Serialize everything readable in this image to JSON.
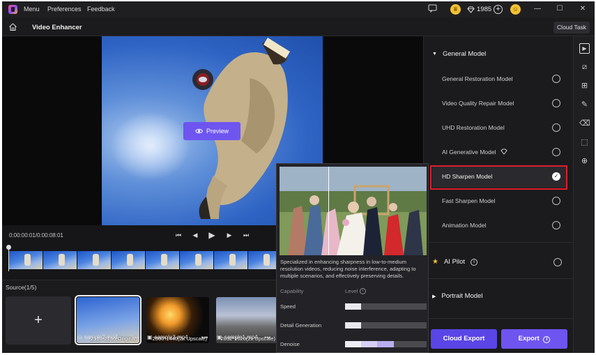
{
  "titlebar": {
    "menu": [
      "Menu",
      "Preferences",
      "Feedback"
    ],
    "credits": "1985",
    "window_controls": [
      "minimize",
      "maximize",
      "close"
    ]
  },
  "header": {
    "title": "Video Enhancer",
    "cloud_task": "Cloud Task"
  },
  "preview": {
    "button": "Preview",
    "timecode": "0:00:00:01/0:00:08:01"
  },
  "source": {
    "label": "Source(1/5)",
    "add": "+",
    "files": [
      {
        "name": "sample2.mp4",
        "resolution": "2510*2156(Original)",
        "selected": true
      },
      {
        "name": "sample3.mp4",
        "resolution": "2560*1440(2x Upscale)",
        "selected": false
      },
      {
        "name": "sample1.mp4",
        "resolution": "2032*1020(2x Upscale)",
        "selected": false
      }
    ]
  },
  "models": {
    "general_header": "General Model",
    "general": [
      {
        "label": "General Restoration Model",
        "selected": false
      },
      {
        "label": "Video Quality Repair Model",
        "selected": false
      },
      {
        "label": "UHD Restoration Model",
        "selected": false
      },
      {
        "label": "AI Generative Model",
        "selected": false,
        "badge": "diamond-icon"
      },
      {
        "label": "HD Sharpen Model",
        "selected": true
      },
      {
        "label": "Fast Sharpen Model",
        "selected": false
      },
      {
        "label": "Animation Model",
        "selected": false
      }
    ],
    "ai_pilot": "AI Pilot",
    "portrait": "Portrait Model"
  },
  "actions": {
    "cloud_export": "Cloud Export",
    "export": "Export"
  },
  "tooltip": {
    "description": "Specialized in enhancing sharpness in low-to-medium resolution videos, reducing noise interference, adapting to multiple scenarios, and effectively preserving details.",
    "capability_header": "Capability",
    "level_header": "Level",
    "metrics": [
      {
        "name": "Speed",
        "level": 0.2
      },
      {
        "name": "Detail Generation",
        "level": 0.2
      },
      {
        "name": "Denoise",
        "level": 0.6
      }
    ]
  },
  "colors": {
    "accent": "#6e55f0",
    "highlight": "#e11d2b",
    "background": "#1b1b1d"
  }
}
